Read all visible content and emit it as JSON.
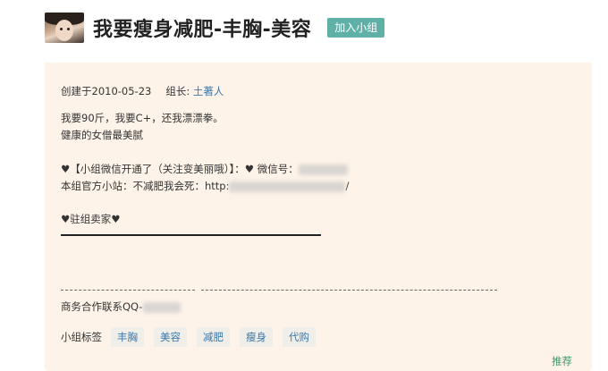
{
  "header": {
    "title": "我要瘦身减肥-丰胸-美容",
    "join_button": "加入小组"
  },
  "info": {
    "created": "创建于2010-05-23",
    "leader_label": "组长:",
    "leader_name": "土著人"
  },
  "intro": {
    "line1": "我要90斤，我要C+，还我漂漂拳。",
    "line2": "健康的女僧最美腻",
    "line3": "♥【小组微信开通了（关注变美丽哦）】：♥ 微信号：",
    "line4_prefix": "本组官方小站：不减肥我会死：http:",
    "line4_suffix": "/",
    "line5": "♥驻组卖家♥"
  },
  "contact": {
    "text": "商务合作联系QQ-"
  },
  "tags": {
    "label": "小组标签",
    "items": [
      "丰胸",
      "美容",
      "减肥",
      "瘦身",
      "代购"
    ]
  },
  "footer": {
    "recommend": "推荐"
  }
}
